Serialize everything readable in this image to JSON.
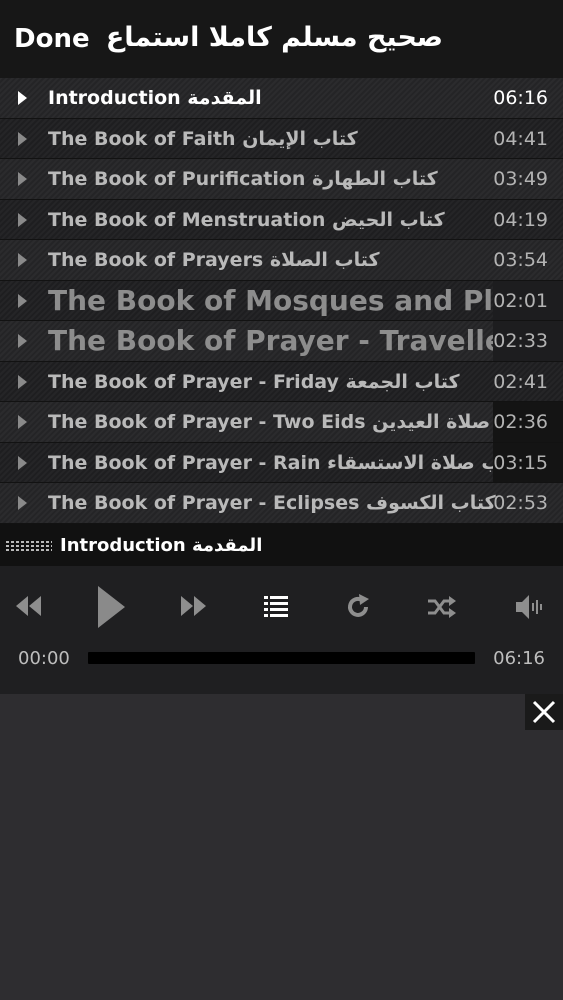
{
  "header": {
    "done_label": "Done",
    "title": "صحيح مسلم كاملا استماع"
  },
  "tracks": [
    {
      "title": "Introduction المقدمة",
      "duration": "06:16",
      "active": true
    },
    {
      "title": "The Book of Faith كتاب الإيمان",
      "duration": "04:41"
    },
    {
      "title": "The Book of Purification كتاب الطهارة",
      "duration": "03:49"
    },
    {
      "title": "The Book of Menstruation كتاب الحيض",
      "duration": "04:19"
    },
    {
      "title": "The Book of Prayers كتاب الصلاة",
      "duration": "03:54"
    },
    {
      "title": "The Book of Mosques and Pla",
      "duration": "02:01"
    },
    {
      "title": "The Book of Prayer - Traveller",
      "duration": "02:33"
    },
    {
      "title": "The Book of Prayer - Friday كتاب الجمعة",
      "duration": "02:41"
    },
    {
      "title": "The Book of Prayer - Two Eids كتاب صلاة العيدين",
      "duration": "02:36"
    },
    {
      "title": "The Book of Prayer - Rain كتاب صلاة الاستسقاء",
      "duration": "03:15"
    },
    {
      "title": "The Book of Prayer - Eclipses كتاب الكسوف",
      "duration": "02:53"
    }
  ],
  "now_playing": {
    "title": "Introduction المقدمة"
  },
  "player": {
    "elapsed": "00:00",
    "total": "06:16",
    "progress": 0,
    "icons": [
      "rewind-icon",
      "play-icon",
      "fast-forward-icon",
      "playlist-icon",
      "repeat-icon",
      "shuffle-icon",
      "volume-icon",
      "close-icon"
    ]
  },
  "colors": {
    "background": "#2e2d30",
    "header": "#171717",
    "text": "#ffffff",
    "muted_text": "#b9b9b9"
  }
}
